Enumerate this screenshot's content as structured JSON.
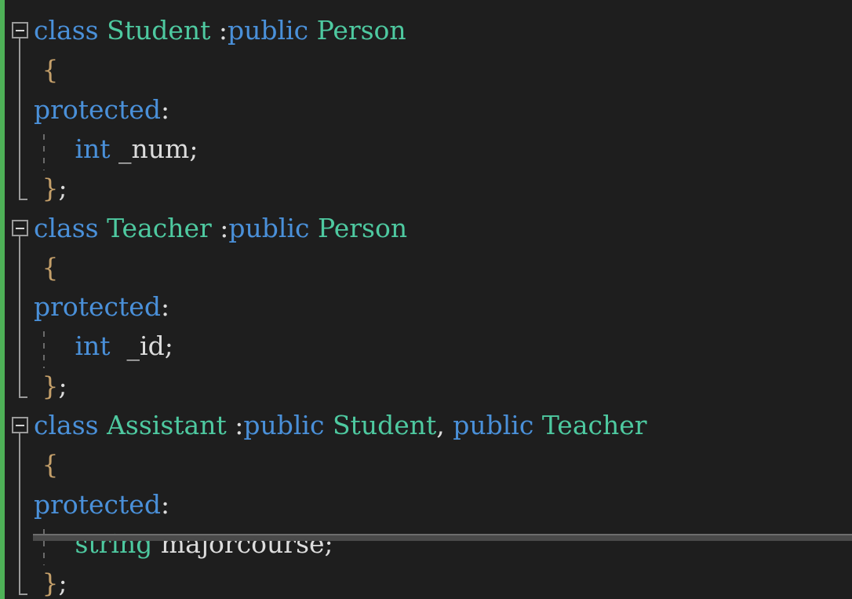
{
  "editor": {
    "theme": "dark",
    "language": "C++",
    "background_color": "#1e1e1e",
    "change_bar_color": "#4eb157",
    "keyword_color": "#4a90d9",
    "type_color": "#4ec9a0",
    "identifier_color": "#dcdcdc",
    "brace_color": "#c5a06a",
    "fold_margin_color": "#9a9a9a",
    "indent_guide_color": "#6b6b6b",
    "scrollbar_color": "#4a4a4a"
  },
  "fold_regions": [
    {
      "name": "fold-region-student",
      "state": "expanded",
      "glyph": "minus-square-icon"
    },
    {
      "name": "fold-region-teacher",
      "state": "expanded",
      "glyph": "minus-square-icon"
    },
    {
      "name": "fold-region-assistant",
      "state": "expanded",
      "glyph": "minus-square-icon"
    }
  ],
  "lines": [
    {
      "text": "class Student :public Person",
      "tokens": [
        {
          "text": "class",
          "kind": "keyword"
        },
        {
          "text": " ",
          "kind": "plain"
        },
        {
          "text": "Student",
          "kind": "type"
        },
        {
          "text": " :",
          "kind": "punct"
        },
        {
          "text": "public",
          "kind": "keyword"
        },
        {
          "text": " ",
          "kind": "plain"
        },
        {
          "text": "Person",
          "kind": "type"
        }
      ]
    },
    {
      "text": " {",
      "tokens": [
        {
          "text": " ",
          "kind": "plain"
        },
        {
          "text": "{",
          "kind": "brace"
        }
      ]
    },
    {
      "text": "protected:",
      "tokens": [
        {
          "text": "protected",
          "kind": "keyword"
        },
        {
          "text": ":",
          "kind": "punct"
        }
      ]
    },
    {
      "text": "     int _num;",
      "tokens": [
        {
          "text": "     ",
          "kind": "plain"
        },
        {
          "text": "int",
          "kind": "keyword"
        },
        {
          "text": " ",
          "kind": "plain"
        },
        {
          "text": "_num",
          "kind": "ident"
        },
        {
          "text": ";",
          "kind": "punct"
        }
      ]
    },
    {
      "text": " };",
      "tokens": [
        {
          "text": " ",
          "kind": "plain"
        },
        {
          "text": "}",
          "kind": "brace"
        },
        {
          "text": ";",
          "kind": "punct"
        }
      ]
    },
    {
      "text": "class Teacher :public Person",
      "tokens": [
        {
          "text": "class",
          "kind": "keyword"
        },
        {
          "text": " ",
          "kind": "plain"
        },
        {
          "text": "Teacher",
          "kind": "type"
        },
        {
          "text": " :",
          "kind": "punct"
        },
        {
          "text": "public",
          "kind": "keyword"
        },
        {
          "text": " ",
          "kind": "plain"
        },
        {
          "text": "Person",
          "kind": "type"
        }
      ]
    },
    {
      "text": " {",
      "tokens": [
        {
          "text": " ",
          "kind": "plain"
        },
        {
          "text": "{",
          "kind": "brace"
        }
      ]
    },
    {
      "text": "protected:",
      "tokens": [
        {
          "text": "protected",
          "kind": "keyword"
        },
        {
          "text": ":",
          "kind": "punct"
        }
      ]
    },
    {
      "text": "     int  _id;",
      "tokens": [
        {
          "text": "     ",
          "kind": "plain"
        },
        {
          "text": "int",
          "kind": "keyword"
        },
        {
          "text": "  ",
          "kind": "plain"
        },
        {
          "text": "_id",
          "kind": "ident"
        },
        {
          "text": ";",
          "kind": "punct"
        }
      ]
    },
    {
      "text": " };",
      "tokens": [
        {
          "text": " ",
          "kind": "plain"
        },
        {
          "text": "}",
          "kind": "brace"
        },
        {
          "text": ";",
          "kind": "punct"
        }
      ]
    },
    {
      "text": "class Assistant :public Student, public Teacher",
      "tokens": [
        {
          "text": "class",
          "kind": "keyword"
        },
        {
          "text": " ",
          "kind": "plain"
        },
        {
          "text": "Assistant",
          "kind": "type"
        },
        {
          "text": " :",
          "kind": "punct"
        },
        {
          "text": "public",
          "kind": "keyword"
        },
        {
          "text": " ",
          "kind": "plain"
        },
        {
          "text": "Student",
          "kind": "type"
        },
        {
          "text": ",",
          "kind": "punct"
        },
        {
          "text": " ",
          "kind": "plain"
        },
        {
          "text": "public",
          "kind": "keyword"
        },
        {
          "text": " ",
          "kind": "plain"
        },
        {
          "text": "Teacher",
          "kind": "type"
        }
      ]
    },
    {
      "text": " {",
      "tokens": [
        {
          "text": " ",
          "kind": "plain"
        },
        {
          "text": "{",
          "kind": "brace"
        }
      ]
    },
    {
      "text": "protected:",
      "tokens": [
        {
          "text": "protected",
          "kind": "keyword"
        },
        {
          "text": ":",
          "kind": "punct"
        }
      ]
    },
    {
      "text": "     string majorcourse;",
      "tokens": [
        {
          "text": "     ",
          "kind": "plain"
        },
        {
          "text": "string",
          "kind": "type"
        },
        {
          "text": " ",
          "kind": "plain"
        },
        {
          "text": "majorcourse",
          "kind": "ident"
        },
        {
          "text": ";",
          "kind": "punct"
        }
      ]
    },
    {
      "text": " };",
      "tokens": [
        {
          "text": " ",
          "kind": "plain"
        },
        {
          "text": "}",
          "kind": "brace"
        },
        {
          "text": ";",
          "kind": "punct"
        }
      ]
    }
  ],
  "scrollbar": {
    "name": "horizontal-scrollbar",
    "orientation": "horizontal",
    "thumb_start_percent": 0,
    "thumb_width_percent": 100
  }
}
